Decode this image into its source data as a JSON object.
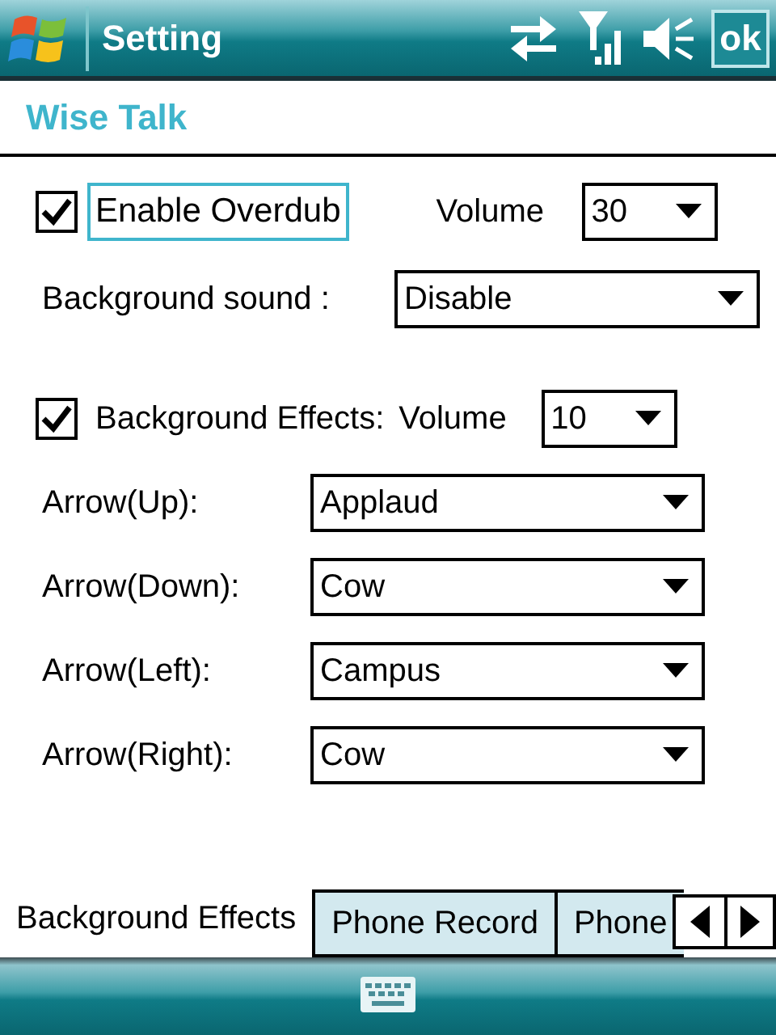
{
  "title_bar": {
    "title": "Setting",
    "ok": "ok"
  },
  "heading": "Wise Talk",
  "overdub": {
    "label": "Enable Overdub",
    "checked": true,
    "focused": true,
    "volume_label": "Volume",
    "volume": "30"
  },
  "background_sound": {
    "label": "Background sound :",
    "value": "Disable"
  },
  "effects": {
    "label": "Background Effects:",
    "checked": true,
    "focused": false,
    "volume_label": "Volume",
    "volume": "10"
  },
  "arrows": [
    {
      "label": "Arrow(Up):",
      "value": "Applaud"
    },
    {
      "label": "Arrow(Down):",
      "value": "Cow"
    },
    {
      "label": "Arrow(Left):",
      "value": "Campus"
    },
    {
      "label": "Arrow(Right):",
      "value": "Cow"
    }
  ],
  "tabs": [
    {
      "label": "Background Effects",
      "selected": true
    },
    {
      "label": "Phone Record",
      "selected": false
    },
    {
      "label": "Phone",
      "selected": false
    }
  ]
}
